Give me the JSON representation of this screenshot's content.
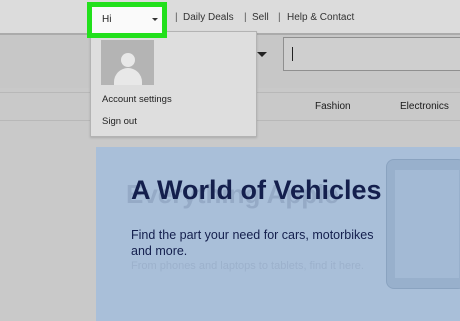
{
  "header": {
    "user_greeting": "Hi",
    "nav_links": [
      "Daily Deals",
      "Sell",
      "Help & Contact"
    ],
    "separator": "|"
  },
  "account_dropdown": {
    "items": [
      "Account settings",
      "Sign out"
    ]
  },
  "categories": [
    "Fashion",
    "Electronics"
  ],
  "hero": {
    "title": "A World of Vehicles",
    "subtitle": "Find the part your need for cars, motorbikes and more.",
    "background_title": "Everything Apple",
    "background_subtitle": "From phones and laptops to tablets, find it here."
  },
  "colors": {
    "highlight": "#22e01c",
    "hero_background": "#a9bfd9",
    "hero_text": "#141f4d"
  }
}
